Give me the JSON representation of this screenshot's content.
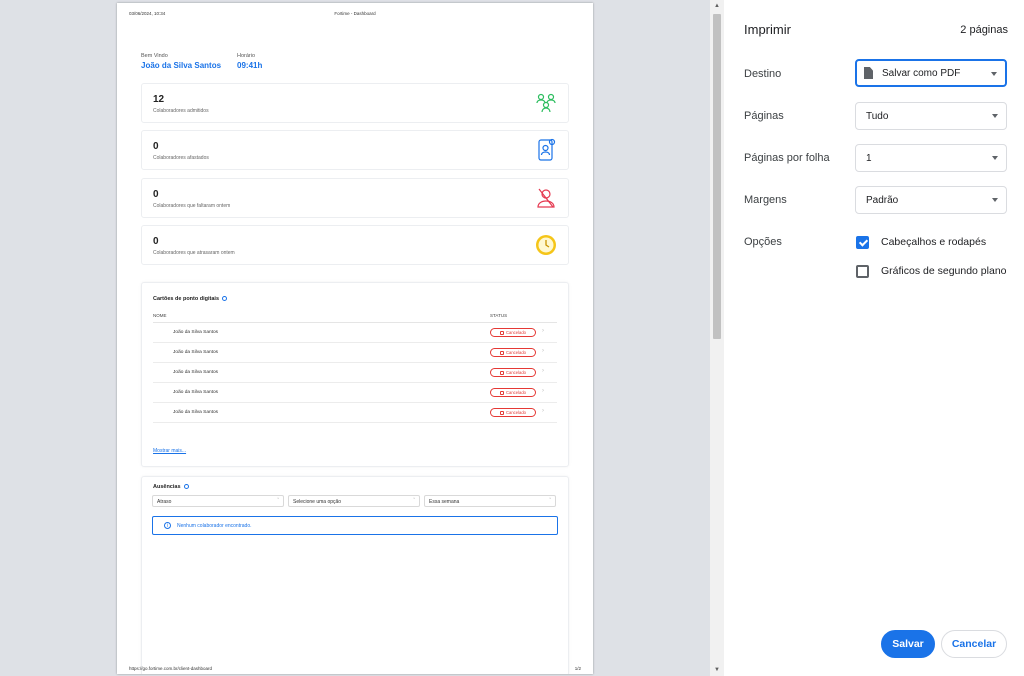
{
  "document": {
    "header_date": "03/06/2024, 10:34",
    "header_title": "Fortime - Dashboard",
    "footer_url": "https://go.fortime.com.br/client-dashboard",
    "footer_page": "1/2",
    "welcome_label": "Bem Vindo",
    "user_name": "João da Silva Santos",
    "time_label": "Horário",
    "time_value": "09:41h",
    "stats": [
      {
        "value": "12",
        "label": "Colaboradores admitidos",
        "icon": "people-icon",
        "color": "#2bbd5e"
      },
      {
        "value": "0",
        "label": "Colaboradores afastados",
        "icon": "phone-user-icon",
        "color": "#1a73e8"
      },
      {
        "value": "0",
        "label": "Colaboradores que faltaram ontem",
        "icon": "absent-user-icon",
        "color": "#e53950"
      },
      {
        "value": "0",
        "label": "Colaboradores que atrasaram ontem",
        "icon": "clock-icon",
        "color": "#f5c518"
      }
    ],
    "cards_title": "Cartões de ponto digitais",
    "table_headers": {
      "name": "NOME",
      "status": "STATUS"
    },
    "rows": [
      {
        "name": "João da Silva Santos",
        "status": "Cancelado"
      },
      {
        "name": "João da Silva Santos",
        "status": "Cancelado"
      },
      {
        "name": "João da Silva Santos",
        "status": "Cancelado"
      },
      {
        "name": "João da Silva Santos",
        "status": "Cancelado"
      },
      {
        "name": "João da Silva Santos",
        "status": "Cancelado"
      }
    ],
    "show_more": "Mostrar mais...",
    "absences_title": "Ausências",
    "filters": [
      "Atraso",
      "Selecione uma opção",
      "Essa semana"
    ],
    "empty_message": "Nenhum colaborador encontrado."
  },
  "settings": {
    "title": "Imprimir",
    "pages_count": "2 páginas",
    "destination_label": "Destino",
    "destination_value": "Salvar como PDF",
    "pages_label": "Páginas",
    "pages_value": "Tudo",
    "per_sheet_label": "Páginas por folha",
    "per_sheet_value": "1",
    "margins_label": "Margens",
    "margins_value": "Padrão",
    "options_label": "Opções",
    "option_headers": "Cabeçalhos e rodapés",
    "option_headers_checked": true,
    "option_background": "Gráficos de segundo plano",
    "option_background_checked": false,
    "save_label": "Salvar",
    "cancel_label": "Cancelar",
    "accent_color": "#1a73e8"
  }
}
